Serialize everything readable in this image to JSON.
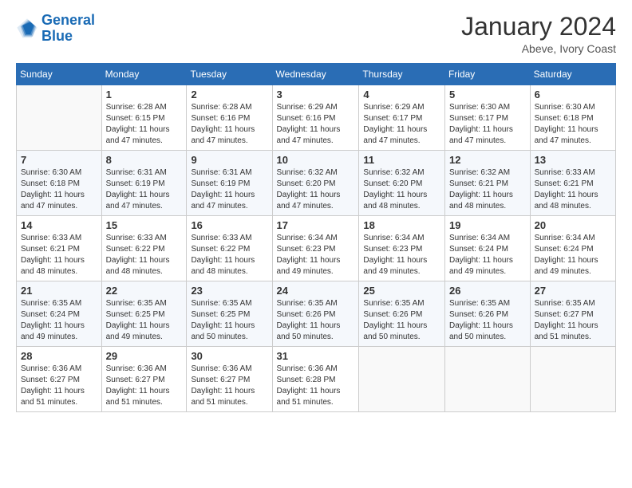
{
  "logo": {
    "line1": "General",
    "line2": "Blue"
  },
  "title": "January 2024",
  "subtitle": "Abeve, Ivory Coast",
  "days_of_week": [
    "Sunday",
    "Monday",
    "Tuesday",
    "Wednesday",
    "Thursday",
    "Friday",
    "Saturday"
  ],
  "weeks": [
    [
      {
        "day": "",
        "sunrise": "",
        "sunset": "",
        "daylight": ""
      },
      {
        "day": "1",
        "sunrise": "6:28 AM",
        "sunset": "6:15 PM",
        "daylight": "11 hours and 47 minutes."
      },
      {
        "day": "2",
        "sunrise": "6:28 AM",
        "sunset": "6:16 PM",
        "daylight": "11 hours and 47 minutes."
      },
      {
        "day": "3",
        "sunrise": "6:29 AM",
        "sunset": "6:16 PM",
        "daylight": "11 hours and 47 minutes."
      },
      {
        "day": "4",
        "sunrise": "6:29 AM",
        "sunset": "6:17 PM",
        "daylight": "11 hours and 47 minutes."
      },
      {
        "day": "5",
        "sunrise": "6:30 AM",
        "sunset": "6:17 PM",
        "daylight": "11 hours and 47 minutes."
      },
      {
        "day": "6",
        "sunrise": "6:30 AM",
        "sunset": "6:18 PM",
        "daylight": "11 hours and 47 minutes."
      }
    ],
    [
      {
        "day": "7",
        "sunrise": "6:30 AM",
        "sunset": "6:18 PM",
        "daylight": "11 hours and 47 minutes."
      },
      {
        "day": "8",
        "sunrise": "6:31 AM",
        "sunset": "6:19 PM",
        "daylight": "11 hours and 47 minutes."
      },
      {
        "day": "9",
        "sunrise": "6:31 AM",
        "sunset": "6:19 PM",
        "daylight": "11 hours and 47 minutes."
      },
      {
        "day": "10",
        "sunrise": "6:32 AM",
        "sunset": "6:20 PM",
        "daylight": "11 hours and 47 minutes."
      },
      {
        "day": "11",
        "sunrise": "6:32 AM",
        "sunset": "6:20 PM",
        "daylight": "11 hours and 48 minutes."
      },
      {
        "day": "12",
        "sunrise": "6:32 AM",
        "sunset": "6:21 PM",
        "daylight": "11 hours and 48 minutes."
      },
      {
        "day": "13",
        "sunrise": "6:33 AM",
        "sunset": "6:21 PM",
        "daylight": "11 hours and 48 minutes."
      }
    ],
    [
      {
        "day": "14",
        "sunrise": "6:33 AM",
        "sunset": "6:21 PM",
        "daylight": "11 hours and 48 minutes."
      },
      {
        "day": "15",
        "sunrise": "6:33 AM",
        "sunset": "6:22 PM",
        "daylight": "11 hours and 48 minutes."
      },
      {
        "day": "16",
        "sunrise": "6:33 AM",
        "sunset": "6:22 PM",
        "daylight": "11 hours and 48 minutes."
      },
      {
        "day": "17",
        "sunrise": "6:34 AM",
        "sunset": "6:23 PM",
        "daylight": "11 hours and 49 minutes."
      },
      {
        "day": "18",
        "sunrise": "6:34 AM",
        "sunset": "6:23 PM",
        "daylight": "11 hours and 49 minutes."
      },
      {
        "day": "19",
        "sunrise": "6:34 AM",
        "sunset": "6:24 PM",
        "daylight": "11 hours and 49 minutes."
      },
      {
        "day": "20",
        "sunrise": "6:34 AM",
        "sunset": "6:24 PM",
        "daylight": "11 hours and 49 minutes."
      }
    ],
    [
      {
        "day": "21",
        "sunrise": "6:35 AM",
        "sunset": "6:24 PM",
        "daylight": "11 hours and 49 minutes."
      },
      {
        "day": "22",
        "sunrise": "6:35 AM",
        "sunset": "6:25 PM",
        "daylight": "11 hours and 49 minutes."
      },
      {
        "day": "23",
        "sunrise": "6:35 AM",
        "sunset": "6:25 PM",
        "daylight": "11 hours and 50 minutes."
      },
      {
        "day": "24",
        "sunrise": "6:35 AM",
        "sunset": "6:26 PM",
        "daylight": "11 hours and 50 minutes."
      },
      {
        "day": "25",
        "sunrise": "6:35 AM",
        "sunset": "6:26 PM",
        "daylight": "11 hours and 50 minutes."
      },
      {
        "day": "26",
        "sunrise": "6:35 AM",
        "sunset": "6:26 PM",
        "daylight": "11 hours and 50 minutes."
      },
      {
        "day": "27",
        "sunrise": "6:35 AM",
        "sunset": "6:27 PM",
        "daylight": "11 hours and 51 minutes."
      }
    ],
    [
      {
        "day": "28",
        "sunrise": "6:36 AM",
        "sunset": "6:27 PM",
        "daylight": "11 hours and 51 minutes."
      },
      {
        "day": "29",
        "sunrise": "6:36 AM",
        "sunset": "6:27 PM",
        "daylight": "11 hours and 51 minutes."
      },
      {
        "day": "30",
        "sunrise": "6:36 AM",
        "sunset": "6:27 PM",
        "daylight": "11 hours and 51 minutes."
      },
      {
        "day": "31",
        "sunrise": "6:36 AM",
        "sunset": "6:28 PM",
        "daylight": "11 hours and 51 minutes."
      },
      {
        "day": "",
        "sunrise": "",
        "sunset": "",
        "daylight": ""
      },
      {
        "day": "",
        "sunrise": "",
        "sunset": "",
        "daylight": ""
      },
      {
        "day": "",
        "sunrise": "",
        "sunset": "",
        "daylight": ""
      }
    ]
  ]
}
